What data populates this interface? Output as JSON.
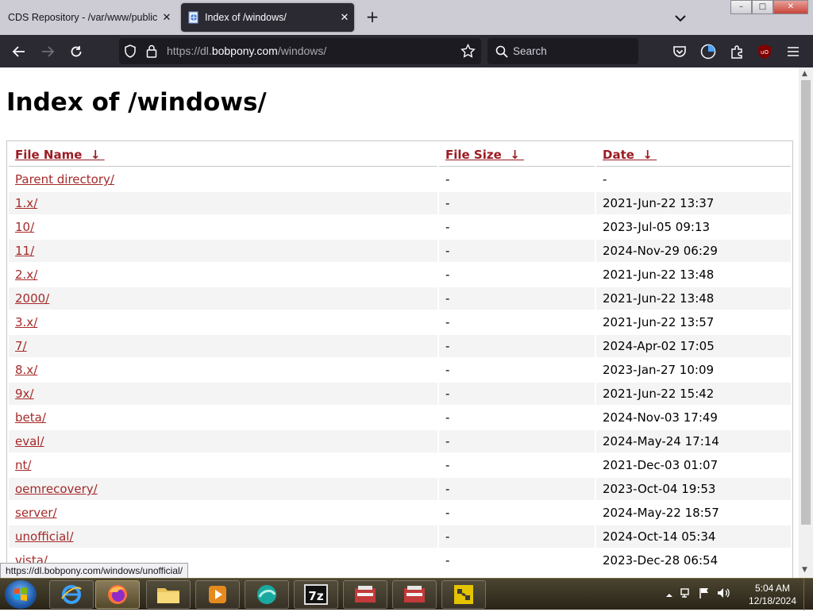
{
  "tabs": [
    {
      "title": "CDS Repository - /var/www/public",
      "close": "✕"
    },
    {
      "title": "Index of /windows/",
      "close": "✕"
    }
  ],
  "new_tab": "+",
  "window_controls": {
    "minimize": "–",
    "maximize": "□",
    "close": "✕"
  },
  "toolbar": {
    "url_prefix": "https://dl.",
    "url_domain": "bobpony.com",
    "url_path": "/windows/",
    "search_placeholder": "Search"
  },
  "page": {
    "title": "Index of /windows/",
    "columns": {
      "name": "File Name",
      "size": "File Size",
      "date": "Date",
      "sort_arrow": "↓"
    },
    "rows": [
      {
        "name": "Parent directory/",
        "size": "-",
        "date": "-"
      },
      {
        "name": "1.x/",
        "size": "-",
        "date": "2021-Jun-22 13:37"
      },
      {
        "name": "10/",
        "size": "-",
        "date": "2023-Jul-05 09:13"
      },
      {
        "name": "11/",
        "size": "-",
        "date": "2024-Nov-29 06:29"
      },
      {
        "name": "2.x/",
        "size": "-",
        "date": "2021-Jun-22 13:48"
      },
      {
        "name": "2000/",
        "size": "-",
        "date": "2021-Jun-22 13:48"
      },
      {
        "name": "3.x/",
        "size": "-",
        "date": "2021-Jun-22 13:57"
      },
      {
        "name": "7/",
        "size": "-",
        "date": "2024-Apr-02 17:05"
      },
      {
        "name": "8.x/",
        "size": "-",
        "date": "2023-Jan-27 10:09"
      },
      {
        "name": "9x/",
        "size": "-",
        "date": "2021-Jun-22 15:42"
      },
      {
        "name": "beta/",
        "size": "-",
        "date": "2024-Nov-03 17:49"
      },
      {
        "name": "eval/",
        "size": "-",
        "date": "2024-May-24 17:14"
      },
      {
        "name": "nt/",
        "size": "-",
        "date": "2021-Dec-03 01:07"
      },
      {
        "name": "oemrecovery/",
        "size": "-",
        "date": "2023-Oct-04 19:53"
      },
      {
        "name": "server/",
        "size": "-",
        "date": "2024-May-22 18:57"
      },
      {
        "name": "unofficial/",
        "size": "-",
        "date": "2024-Oct-14 05:34"
      },
      {
        "name": "vista/",
        "size": "-",
        "date": "2023-Dec-28 06:54"
      }
    ]
  },
  "status_url": "https://dl.bobpony.com/windows/unofficial/",
  "taskbar": {
    "clock_time": "5:04 AM",
    "clock_date": "12/18/2024",
    "seven_zip_label": "7z"
  },
  "colors": {
    "link": "#a52a2a",
    "header_link": "#9b1c23",
    "toolbar_bg": "#2b2a33",
    "tabstrip_bg": "#cdcbd3"
  }
}
